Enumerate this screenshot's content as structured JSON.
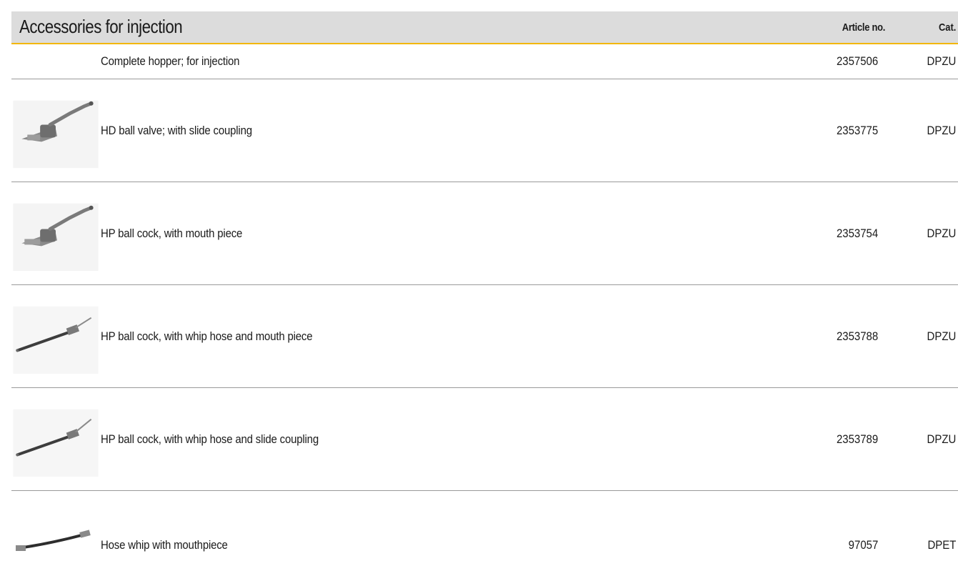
{
  "header": {
    "title": "Accessories for injection",
    "article_label": "Article no.",
    "cat_label": "Cat."
  },
  "rows": [
    {
      "description": "Complete hopper; for injection",
      "article": "2357506",
      "cat": "DPZU",
      "image": "none"
    },
    {
      "description": "HD ball valve; with slide coupling",
      "article": "2353775",
      "cat": "DPZU",
      "image": "ball-valve-photo"
    },
    {
      "description": "HP ball cock, with mouth piece",
      "article": "2353754",
      "cat": "DPZU",
      "image": "ball-cock-photo"
    },
    {
      "description": "HP ball cock, with whip hose and mouth piece",
      "article": "2353788",
      "cat": "DPZU",
      "image": "whip-hose-photo"
    },
    {
      "description": "HP ball cock, with whip hose and slide coupling",
      "article": "2353789",
      "cat": "DPZU",
      "image": "whip-hose-photo"
    },
    {
      "description": "Hose whip with mouthpiece",
      "article": "97057",
      "cat": "DPET",
      "image": "hose-whip-photo"
    }
  ],
  "colors": {
    "header_bg": "#dcdcdc",
    "header_rule": "#f2b705",
    "row_rule": "#9a9a9a"
  }
}
